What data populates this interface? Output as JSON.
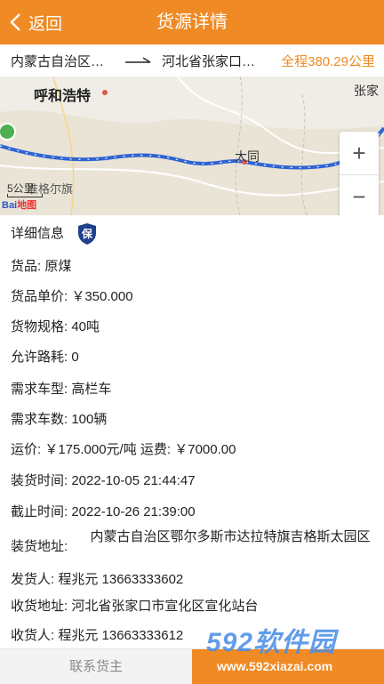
{
  "header": {
    "back_label": "返回",
    "title": "货源详情"
  },
  "route": {
    "from": "内蒙古自治区…",
    "to": "河北省张家口…",
    "total": "全程380.29公里"
  },
  "map": {
    "cities": {
      "hohhot": "呼和浩特",
      "zhang": "张家",
      "datong": "大同",
      "banner": "准格尔旗"
    },
    "scale": "5公里",
    "logo_a": "Bai",
    "logo_b": "地图",
    "zoom_in": "+",
    "zoom_out": "−"
  },
  "details": {
    "section_title": "详细信息",
    "badge": "保",
    "goods": "货品:  原煤",
    "unit_price": "货品单价:  ￥350.000",
    "spec": "货物规格:  40吨",
    "loss": "允许路耗:  0",
    "truck_type": "需求车型:  高栏车",
    "truck_count": "需求车数:  100辆",
    "freight": "运价:  ￥175.000元/吨   运费:  ￥7000.00",
    "load_time": "装货时间:  2022-10-05 21:44:47",
    "deadline": "截止时间:  2022-10-26 21:39:00",
    "load_addr_label": "装货地址:",
    "load_addr": "内蒙古自治区鄂尔多斯市达拉特旗吉格斯太园区",
    "sender": "发货人:  程兆元  13663333602",
    "recv_addr": "收货地址:  河北省张家口市宣化区宣化站台",
    "receiver": "收货人:  程兆元  13663333612"
  },
  "bottom": {
    "contact": "联系货主"
  },
  "watermark": {
    "brand": "592软件园",
    "url": "www.592xiazai.com"
  }
}
